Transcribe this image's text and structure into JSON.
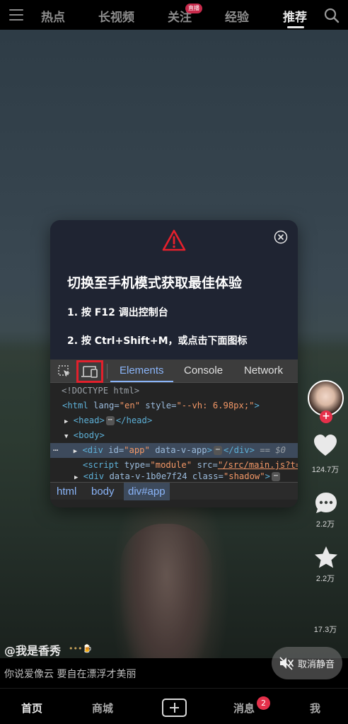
{
  "top_nav": {
    "tabs": [
      {
        "label": "热点"
      },
      {
        "label": "长视频"
      },
      {
        "label": "关注"
      },
      {
        "label": "经验"
      },
      {
        "label": "推荐"
      }
    ],
    "live_badge": "直播",
    "active_tab": "推荐"
  },
  "modal": {
    "title": "切换至手机模式获取最佳体验",
    "steps": [
      "1. 按 F12 调出控制台",
      "2. 按 Ctrl+Shift+M，或点击下面图标"
    ],
    "devtools": {
      "tabs": [
        "Elements",
        "Console",
        "Network"
      ],
      "active_tab": "Elements",
      "code": {
        "doctype": "<!DOCTYPE html>",
        "html_open_tag": "<html",
        "html_lang_attr": "lang=",
        "html_lang_val": "\"en\"",
        "html_style_attr": "style=",
        "html_style_val": "\"--vh: 6.98px;\"",
        "html_close": ">",
        "head_open": "<head>",
        "head_close": "</head>",
        "body_open": "<body>",
        "div_open": "<div",
        "div_id_attr": "id=",
        "div_id_val": "\"app\"",
        "div_data_attr": "data-v-app",
        "div_close_open": ">",
        "div_end": "</div>",
        "div_eq": "== $0",
        "script_open": "<script",
        "script_type_attr": "type=",
        "script_type_val": "\"module\"",
        "script_src_attr": "src=",
        "script_src_val": "\"/src/main.js?t=",
        "div2_open": "<div",
        "div2_data_attr": "data-v-1b0e7f24",
        "div2_class_attr": "class=",
        "div2_class_val": "\"shadow\"",
        "ellipsis": "⋯",
        "dots": "…"
      },
      "breadcrumbs": [
        "html",
        "body",
        "div#app"
      ]
    }
  },
  "actions": {
    "like_count": "124.7万",
    "comment_count": "2.2万",
    "favorite_count": "2.2万",
    "share_count": "17.3万",
    "follow_plus": "+"
  },
  "author": {
    "name": "@我是香秀",
    "badge": "•••🍺"
  },
  "caption": "你说爱像云 要自在漂浮才美丽",
  "unmute_label": "取消静音",
  "bottom_bar": {
    "home": "首页",
    "mall": "商城",
    "messages": "消息",
    "messages_badge": "2",
    "me": "我"
  },
  "colors": {
    "accent_red": "#e5304a",
    "devtools_blue": "#8ab4f8",
    "highlight_red": "#e2202c"
  }
}
